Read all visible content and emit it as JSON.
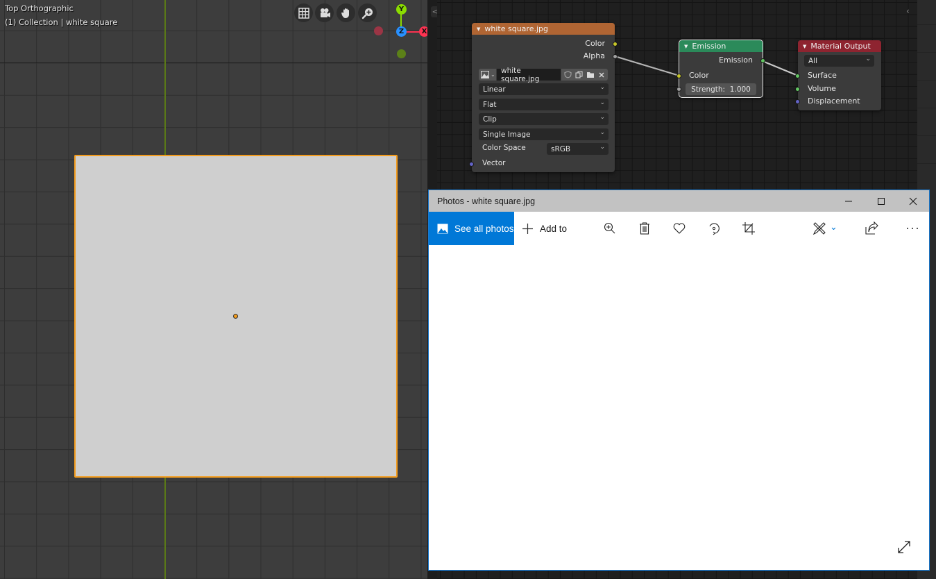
{
  "viewport": {
    "view_name": "Top Orthographic",
    "collection_label": "(1) Collection | white square",
    "nav_buttons": [
      {
        "name": "toggle-camera-view",
        "icon": "grid-icon"
      },
      {
        "name": "camera-view",
        "icon": "camera-icon"
      },
      {
        "name": "pan-view",
        "icon": "hand-icon"
      },
      {
        "name": "zoom-view",
        "icon": "zoom-in-icon"
      }
    ],
    "gizmo": {
      "y_label": "Y",
      "z_label": "Z",
      "x_label": "X",
      "colors": {
        "x": "#ff3352",
        "y": "#8bdc00",
        "z": "#2890ff"
      }
    },
    "selected_object": "white square",
    "selection_color": "#f39c1d"
  },
  "node_editor": {
    "nodes": {
      "image_texture": {
        "title": "white square.jpg",
        "header_color": "#b06533",
        "outputs": [
          "Color",
          "Alpha"
        ],
        "image_name": "white square.jpg",
        "interpolation": "Linear",
        "projection": "Flat",
        "extension": "Clip",
        "source": "Single Image",
        "color_space_label": "Color Space",
        "color_space": "sRGB",
        "inputs": [
          "Vector"
        ]
      },
      "emission": {
        "title": "Emission",
        "header_color": "#2b8a5a",
        "output": "Emission",
        "color_input": "Color",
        "strength_label": "Strength:",
        "strength_value": "1.000"
      },
      "material_output": {
        "title": "Material Output",
        "header_color": "#8e2430",
        "target": "All",
        "inputs": [
          "Surface",
          "Volume",
          "Displacement"
        ]
      }
    }
  },
  "photos": {
    "title": "Photos - white square.jpg",
    "window_controls": {
      "minimize": "minimize",
      "maximize": "maximize",
      "close": "close"
    },
    "toolbar": {
      "see_all_label": "See all photos",
      "add_to_label": "Add to",
      "icons": [
        "zoom-in-icon",
        "delete-icon",
        "favorite-icon",
        "rotate-icon",
        "crop-icon",
        "edit-create-icon",
        "share-icon",
        "more-icon"
      ]
    },
    "accent_color": "#0078d7"
  }
}
